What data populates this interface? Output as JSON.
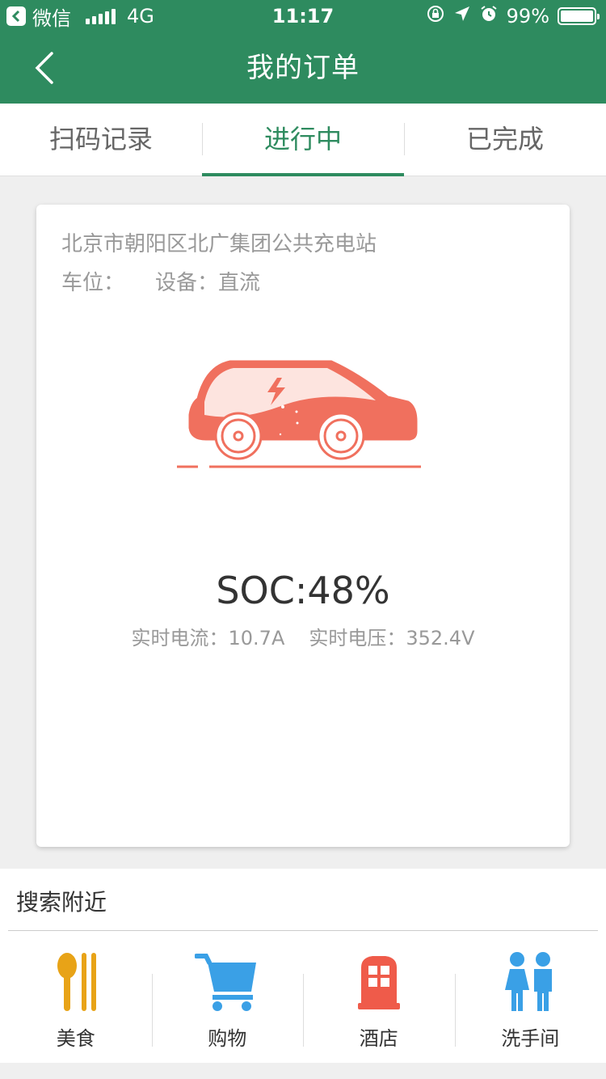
{
  "status_bar": {
    "back_app": "微信",
    "network": "4G",
    "time": "11:17",
    "battery": "99%",
    "battery_level": 0.99
  },
  "header": {
    "title": "我的订单"
  },
  "tabs": [
    {
      "label": "扫码记录",
      "active": false
    },
    {
      "label": "进行中",
      "active": true
    },
    {
      "label": "已完成",
      "active": false
    }
  ],
  "order": {
    "station": "北京市朝阳区北广集团公共充电站",
    "parking_label": "车位：",
    "parking_value": "",
    "device_label": "设备：",
    "device_value": "直流",
    "soc": "SOC:48%",
    "current_label": "实时电流：",
    "current_value": "10.7A",
    "voltage_label": "实时电压：",
    "voltage_value": "352.4V"
  },
  "nearby": {
    "title": "搜索附近",
    "items": [
      {
        "label": "美食",
        "icon": "food-icon",
        "color": "#e8a317"
      },
      {
        "label": "购物",
        "icon": "shopping-cart-icon",
        "color": "#3aa0e6"
      },
      {
        "label": "酒店",
        "icon": "hotel-icon",
        "color": "#ef5b4a"
      },
      {
        "label": "洗手间",
        "icon": "restroom-icon",
        "color": "#3aa0e6"
      }
    ]
  },
  "colors": {
    "brand": "#2e8b5f",
    "car": "#f0705e"
  }
}
